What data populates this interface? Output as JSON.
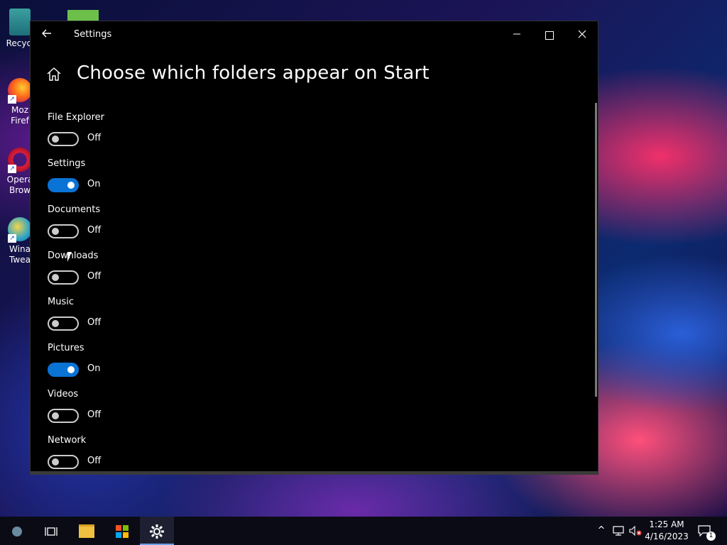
{
  "desktop": {
    "icons": [
      {
        "label_line1": "Recycl",
        "label_line2": ""
      },
      {
        "label_line1": "Moz",
        "label_line2": "Firef"
      },
      {
        "label_line1": "Opera",
        "label_line2": "Brow"
      },
      {
        "label_line1": "Wina",
        "label_line2": "Twea"
      }
    ]
  },
  "window": {
    "title": "Settings",
    "back_icon": "back-arrow-icon",
    "minimize_label": "—",
    "close_label": "✕"
  },
  "page": {
    "title": "Choose which folders appear on Start",
    "home_icon": "home-icon"
  },
  "folders": [
    {
      "label": "File Explorer",
      "on": false,
      "state": "Off"
    },
    {
      "label": "Settings",
      "on": true,
      "state": "On"
    },
    {
      "label": "Documents",
      "on": false,
      "state": "Off"
    },
    {
      "label": "Downloads",
      "on": false,
      "state": "Off"
    },
    {
      "label": "Music",
      "on": false,
      "state": "Off"
    },
    {
      "label": "Pictures",
      "on": true,
      "state": "On"
    },
    {
      "label": "Videos",
      "on": false,
      "state": "Off"
    },
    {
      "label": "Network",
      "on": false,
      "state": "Off"
    }
  ],
  "taskbar": {
    "items": [
      "start-orb-icon",
      "task-view-icon",
      "file-explorer-icon",
      "microsoft-store-icon",
      "settings-gear-icon"
    ],
    "tray_chevron": "^",
    "clock_time": "1:25 AM",
    "clock_date": "4/16/2023",
    "notification_count": "1"
  },
  "colors": {
    "toggle_on": "#0a73d6",
    "window_bg": "#000000"
  }
}
